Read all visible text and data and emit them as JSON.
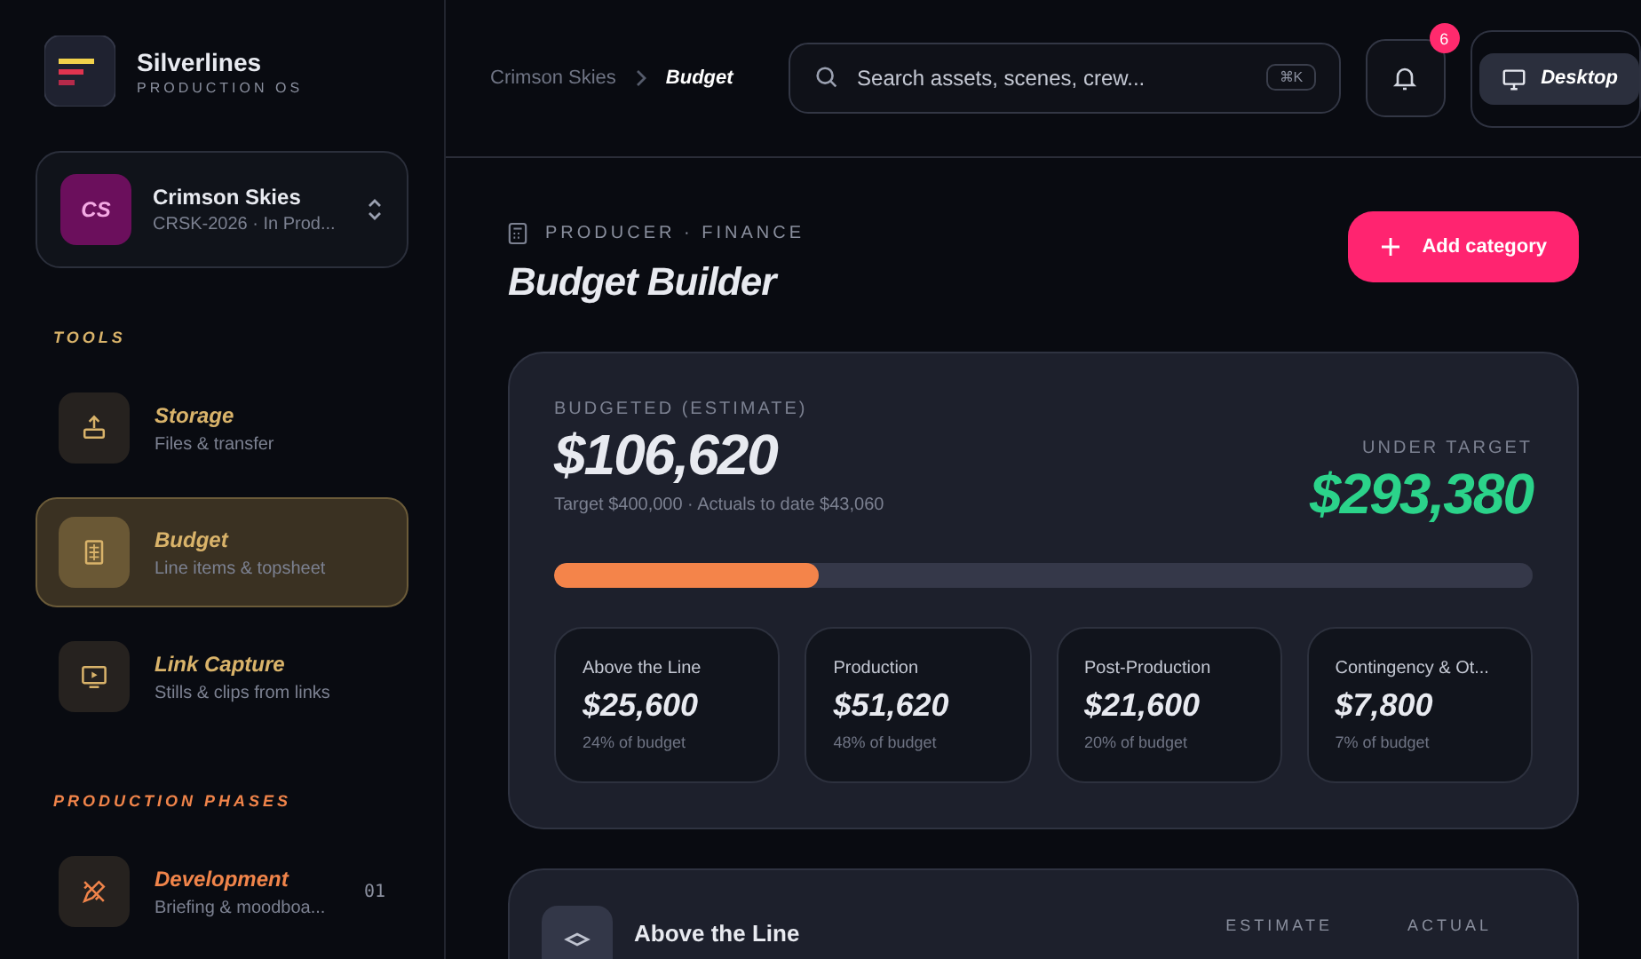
{
  "brand": {
    "name": "Silverlines",
    "tagline": "PRODUCTION OS"
  },
  "project": {
    "initials": "CS",
    "name": "Crimson Skies",
    "meta": "CRSK-2026 · In Prod..."
  },
  "sections": [
    {
      "title": "TOOLS",
      "color": "#d9b36a",
      "items": [
        {
          "kind": "upload",
          "label": "Storage",
          "sub": "Files & transfer",
          "selected": false
        },
        {
          "kind": "sheet",
          "label": "Budget",
          "sub": "Line items & topsheet",
          "selected": true
        },
        {
          "kind": "screen",
          "label": "Link Capture",
          "sub": "Stills & clips from links",
          "selected": false
        }
      ]
    },
    {
      "title": "PRODUCTION PHASES",
      "color": "#f0844a",
      "items": [
        {
          "kind": "pencil",
          "label": "Development",
          "sub": "Briefing & moodboa...",
          "number": "01",
          "selected": false
        }
      ]
    }
  ],
  "breadcrumb": [
    "Crimson Skies",
    "Budget"
  ],
  "search": {
    "placeholder": "Search assets, scenes, crew...",
    "shortcut": "⌘K"
  },
  "notifications": {
    "count": "6"
  },
  "view_button": "Desktop",
  "page": {
    "eyebrow": "PRODUCER · FINANCE",
    "title": "Budget Builder",
    "action": "Add category"
  },
  "summary": {
    "label": "BUDGETED (ESTIMATE)",
    "amount": "$106,620",
    "note": "Target $400,000 · Actuals to date $43,060",
    "right_label": "UNDER TARGET",
    "right_amount": "$293,380",
    "level": 0.27
  },
  "categories": [
    {
      "name": "Above the Line",
      "amount": "$25,600",
      "share": "24% of budget"
    },
    {
      "name": "Production",
      "amount": "$51,620",
      "share": "48% of budget"
    },
    {
      "name": "Post-Production",
      "amount": "$21,600",
      "share": "20% of budget"
    },
    {
      "name": "Contingency & Ot...",
      "amount": "$7,800",
      "share": "7% of budget"
    }
  ],
  "section_card": {
    "title": "Above the Line",
    "columns": [
      "ESTIMATE",
      "ACTUAL"
    ]
  }
}
